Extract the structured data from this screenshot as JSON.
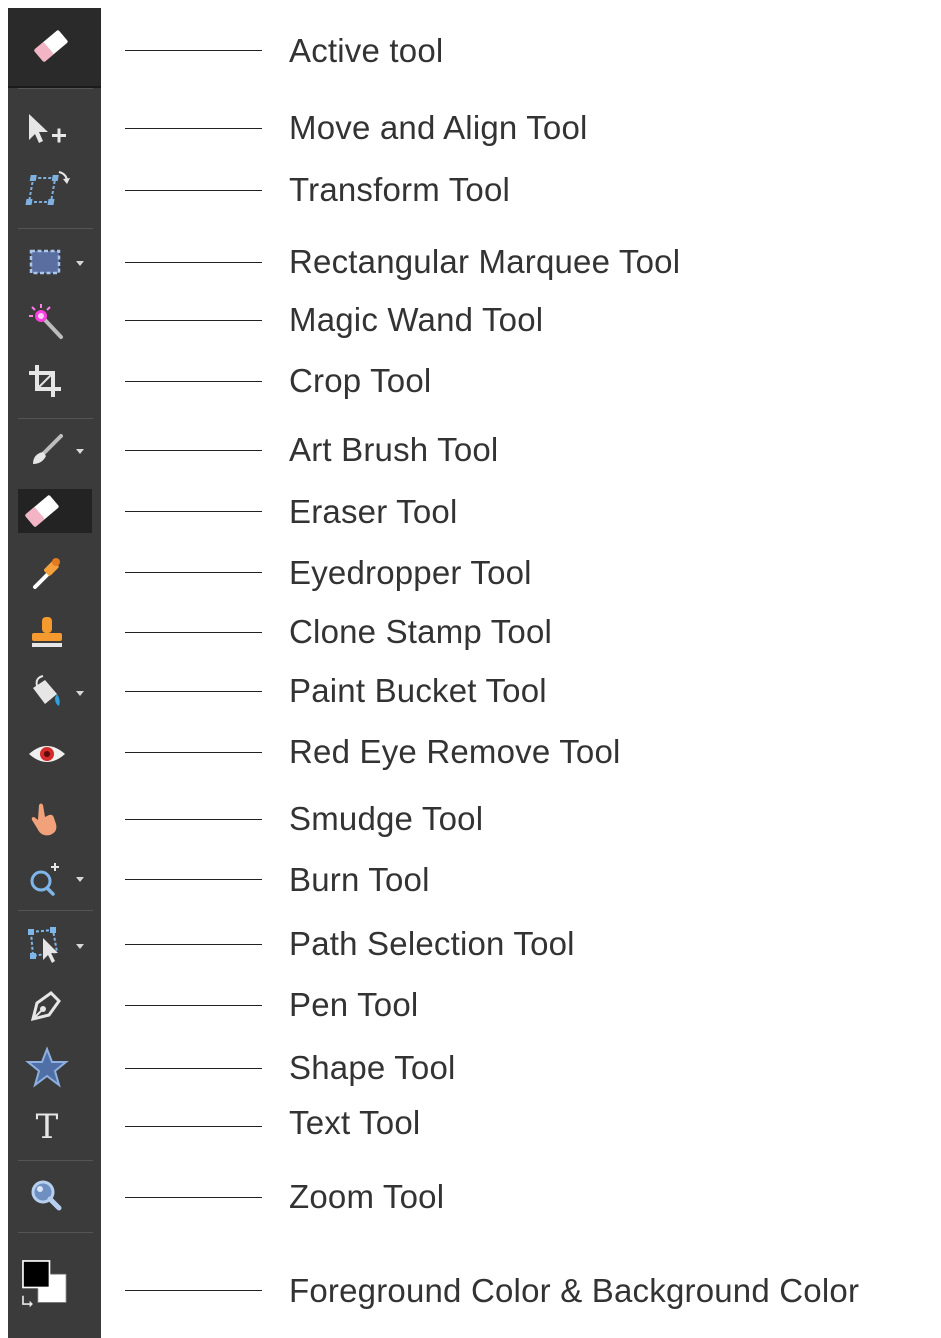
{
  "toolbar": {
    "active_tool_icon": "eraser-icon",
    "tools": [
      {
        "icon": "move-align-icon"
      },
      {
        "icon": "transform-icon"
      },
      {
        "icon": "rectangular-marquee-icon"
      },
      {
        "icon": "magic-wand-icon"
      },
      {
        "icon": "crop-icon"
      },
      {
        "icon": "art-brush-icon"
      },
      {
        "icon": "eraser-icon",
        "selected": true
      },
      {
        "icon": "eyedropper-icon"
      },
      {
        "icon": "clone-stamp-icon"
      },
      {
        "icon": "paint-bucket-icon"
      },
      {
        "icon": "red-eye-icon"
      },
      {
        "icon": "smudge-icon"
      },
      {
        "icon": "burn-icon"
      },
      {
        "icon": "path-selection-icon"
      },
      {
        "icon": "pen-icon"
      },
      {
        "icon": "shape-icon"
      },
      {
        "icon": "text-icon"
      },
      {
        "icon": "zoom-icon"
      },
      {
        "icon": "color-swatches-icon"
      }
    ],
    "text_tool_glyph": "T",
    "colors": {
      "panel": "#3b3b3b",
      "active": "#2a2a2a",
      "foreground": "#000000",
      "background": "#ffffff"
    }
  },
  "labels": {
    "active_tool": "Active tool",
    "move_align": "Move and Align Tool",
    "transform": "Transform Tool",
    "rect_marquee": "Rectangular Marquee Tool",
    "magic_wand": "Magic Wand Tool",
    "crop": "Crop Tool",
    "art_brush": "Art Brush Tool",
    "eraser": "Eraser Tool",
    "eyedropper": "Eyedropper Tool",
    "clone_stamp": "Clone Stamp Tool",
    "paint_bucket": "Paint Bucket Tool",
    "red_eye": "Red Eye Remove Tool",
    "smudge": "Smudge Tool",
    "burn": "Burn Tool",
    "path_selection": "Path Selection Tool",
    "pen": "Pen Tool",
    "shape": "Shape Tool",
    "text": "Text Tool",
    "zoom": "Zoom Tool",
    "colors": "Foreground Color & Background Color"
  }
}
